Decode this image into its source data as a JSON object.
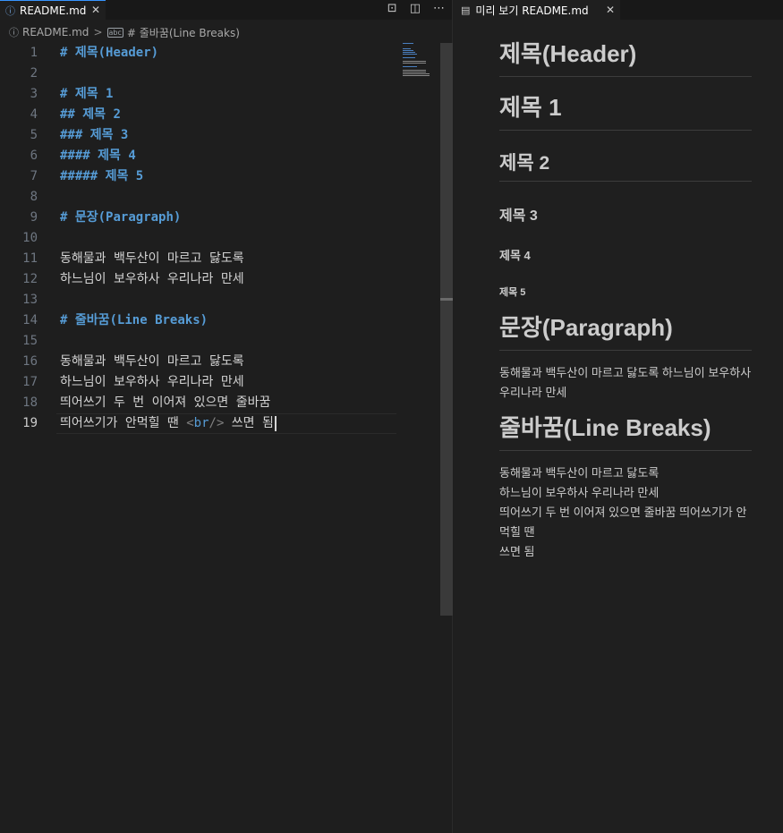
{
  "editor": {
    "tab": {
      "label": "README.md",
      "close": "✕"
    },
    "tab_actions": [
      "⊡",
      "◫",
      "⋯"
    ],
    "breadcrumb": {
      "file": "README.md",
      "separator": ">",
      "symbol_icon": "abc",
      "symbol": "# 줄바꿈(Line Breaks)"
    },
    "lines": [
      {
        "n": "1",
        "text": "# 제목(Header)"
      },
      {
        "n": "2",
        "text": ""
      },
      {
        "n": "3",
        "text": "# 제목 1"
      },
      {
        "n": "4",
        "text": "## 제목 2"
      },
      {
        "n": "5",
        "text": "### 제목 3"
      },
      {
        "n": "6",
        "text": "#### 제목 4"
      },
      {
        "n": "7",
        "text": "##### 제목 5"
      },
      {
        "n": "8",
        "text": ""
      },
      {
        "n": "9",
        "text": "# 문장(Paragraph)"
      },
      {
        "n": "10",
        "text": ""
      },
      {
        "n": "11",
        "text": "동해물과 백두산이 마르고 닳도록"
      },
      {
        "n": "12",
        "text": "하느님이 보우하사 우리나라 만세"
      },
      {
        "n": "13",
        "text": ""
      },
      {
        "n": "14",
        "text": "# 줄바꿈(Line Breaks)"
      },
      {
        "n": "15",
        "text": ""
      },
      {
        "n": "16",
        "text": "동해물과 백두산이 마르고 닳도록"
      },
      {
        "n": "17",
        "text": "하느님이 보우하사 우리나라 만세"
      },
      {
        "n": "18",
        "text": "띄어쓰기 두 번 이어져 있으면 줄바꿈"
      },
      {
        "n": "19",
        "text_before": "띄어쓰기가 안먹힐 땐 ",
        "tag_open": "<",
        "tag_name": "br",
        "tag_close": "/>",
        "text_after": " 쓰면 됨"
      }
    ]
  },
  "preview": {
    "tab": {
      "label": "미리 보기 README.md",
      "close": "✕"
    },
    "h1_header": "제목(Header)",
    "h1_1": "제목 1",
    "h2": "제목 2",
    "h3": "제목 3",
    "h4": "제목 4",
    "h5": "제목 5",
    "h1_paragraph": "문장(Paragraph)",
    "paragraph": "동해물과 백두산이 마르고 닳도록 하느님이 보우하사 우리나라 만세",
    "h1_linebreaks": "줄바꿈(Line Breaks)",
    "lb_line1": "동해물과 백두산이 마르고 닳도록",
    "lb_line2": "하느님이 보우하사 우리나라 만세",
    "lb_line3": "띄어쓰기 두 번 이어져 있으면 줄바꿈 띄어쓰기가 안먹힐 땐",
    "lb_line4": "쓰면 됨"
  },
  "colors": {
    "accent": "#3794ff",
    "heading": "#569cd6",
    "background": "#1e1e1e"
  }
}
